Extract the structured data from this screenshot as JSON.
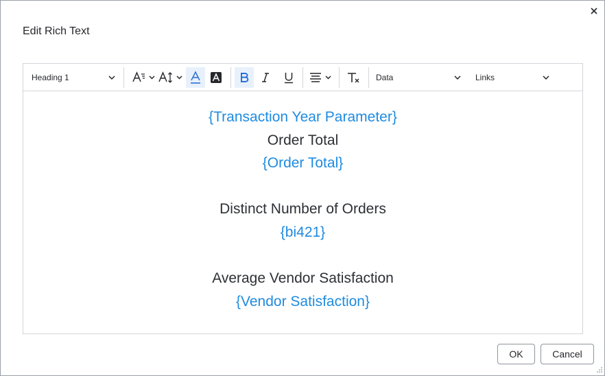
{
  "dialog": {
    "title": "Edit Rich Text",
    "ok_label": "OK",
    "cancel_label": "Cancel"
  },
  "toolbar": {
    "block_format": "Heading 1",
    "data_menu": "Data",
    "links_menu": "Links"
  },
  "content": {
    "lines": [
      {
        "text": "{Transaction Year Parameter}",
        "style": "parameter"
      },
      {
        "text": "Order Total",
        "style": "label"
      },
      {
        "text": "{Order Total}",
        "style": "parameter"
      },
      {
        "text": "",
        "style": "blank"
      },
      {
        "text": "Distinct Number of Orders",
        "style": "label"
      },
      {
        "text": "{bi421}",
        "style": "parameter"
      },
      {
        "text": "",
        "style": "blank"
      },
      {
        "text": "Average Vendor Satisfaction",
        "style": "label"
      },
      {
        "text": "{Vendor Satisfaction}",
        "style": "parameter"
      }
    ]
  },
  "colors": {
    "parameter_text": "#1e8be0",
    "label_text": "#2d3035",
    "active_button_bg": "#e8f1fb",
    "bold_icon": "#2a6fd6"
  }
}
